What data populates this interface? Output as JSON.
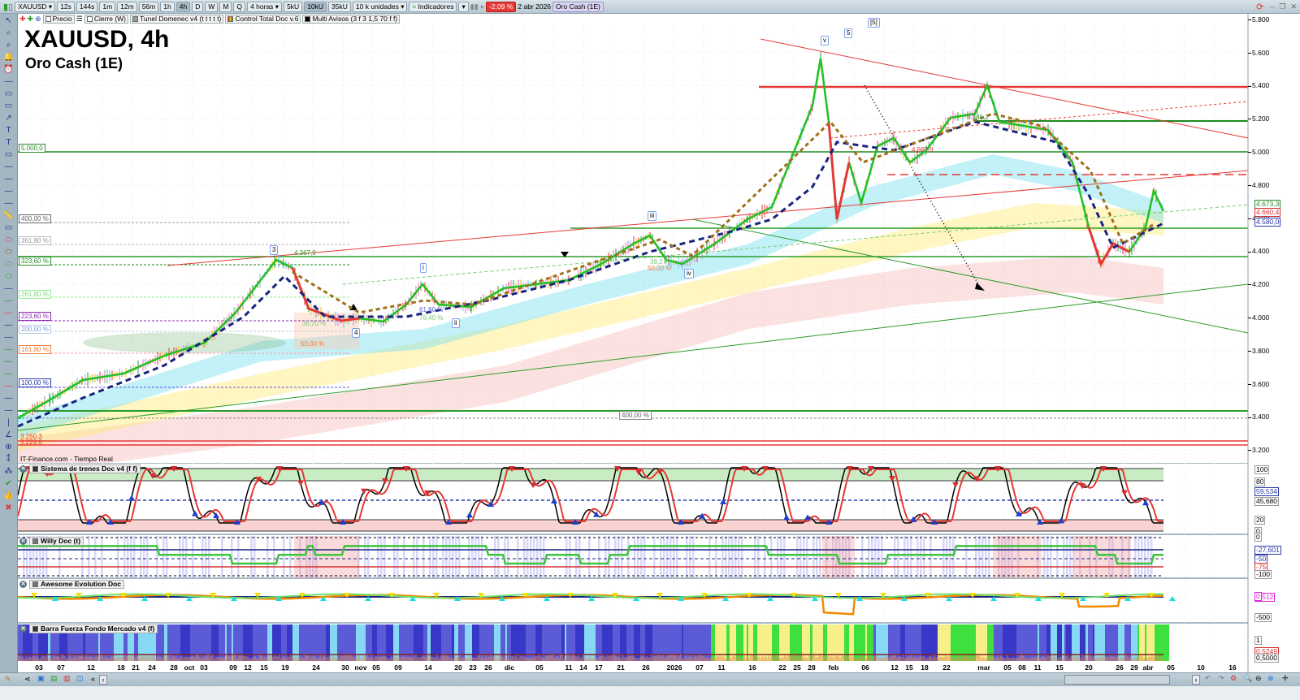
{
  "toolbar": {
    "symbol": "XAUUSD",
    "timeframes": [
      "12s",
      "144s",
      "1m",
      "12m",
      "56m",
      "1h",
      "4h",
      "D",
      "W",
      "M",
      "Q"
    ],
    "active_timeframe": "4h",
    "period": "4 horas",
    "units": [
      "5kU",
      "10kU",
      "35kU"
    ],
    "active_unit": "10kU",
    "unit_select": "10 k unidades",
    "indicators": "Indicadores",
    "change": "-2,09 %",
    "date": "2 abr 2026",
    "instrument": "Oro Cash (1E)"
  },
  "legend": {
    "items": [
      "Precio",
      "Cierre (W)",
      "Tunel Domenec v4 (t t t t t)",
      "Control Total Doc v.6",
      "Multi Avisos (3 f 3 1,5 70 f f)"
    ]
  },
  "chart": {
    "title": "XAUUSD, 4h",
    "subtitle": "Oro Cash (1E)",
    "source": "IT-Finance.com - Tiempo Real",
    "price_axis": [
      "5.800",
      "5.600",
      "5.400",
      "5.200",
      "5.000",
      "4.800",
      "4.600",
      "4.400",
      "4.200",
      "4.000",
      "3.800",
      "3.600",
      "3.400",
      "3.200"
    ],
    "price_tags": {
      "a": "4.673,3",
      "b": "4.660,4",
      "c": "4.580,0"
    },
    "level_5000": "5.000,0",
    "level_low_a": "3.260,3",
    "level_low_b": "3.229,6",
    "fib": [
      "400,00 %",
      "361,80 %",
      "323,60 %",
      "261,80 %",
      "223,60 %",
      "200,00 %",
      "161,80 %",
      "100,00 %"
    ],
    "fib_mid": "400,00 %",
    "waves": {
      "w3": "3",
      "w4": "4",
      "wi": "i",
      "wii": "ii",
      "wiii": "iii",
      "wiv": "iv",
      "wv": "v",
      "w5": "5",
      "w5b": "[5]"
    },
    "annotations": {
      "high": "4.367,9",
      "r382": "38,20 %",
      "r50a": "50,00 %",
      "r618": "61,80 %",
      "r764": "76,40 %",
      "r382b": "38,2 %",
      "r50b": "50,00 %",
      "lvl5183": "5.185,2",
      "lvl4987": "4.987,9"
    }
  },
  "panels": [
    {
      "title": "Sistema de trenes Doc v4 (f f)",
      "axis": [
        "100",
        "80",
        "59,534",
        "45,680",
        "20",
        "0"
      ]
    },
    {
      "title": "Willy Doc (t)",
      "axis": [
        "0",
        "-27,601",
        "-50",
        "-75",
        "-100"
      ]
    },
    {
      "title": "Awesome Evolution Doc",
      "axis": [
        "4,512",
        "0",
        "-500"
      ]
    },
    {
      "title": "Barra Fuerza Fondo Mercado v4 (f)",
      "axis": [
        "1",
        "0,5249",
        "0,5000"
      ]
    }
  ],
  "dates": [
    "03",
    "07",
    "12",
    "18",
    "21",
    "24",
    "28",
    "oct",
    "03",
    "09",
    "12",
    "15",
    "19",
    "24",
    "30",
    "nov",
    "05",
    "09",
    "14",
    "20",
    "23",
    "26",
    "dic",
    "05",
    "11",
    "14",
    "17",
    "21",
    "26",
    "2026",
    "07",
    "11",
    "16",
    "22",
    "25",
    "28",
    "feb",
    "06",
    "12",
    "15",
    "18",
    "22",
    "mar",
    "05",
    "08",
    "11",
    "15",
    "20",
    "26",
    "29",
    "abr",
    "05",
    "10",
    "16"
  ]
}
